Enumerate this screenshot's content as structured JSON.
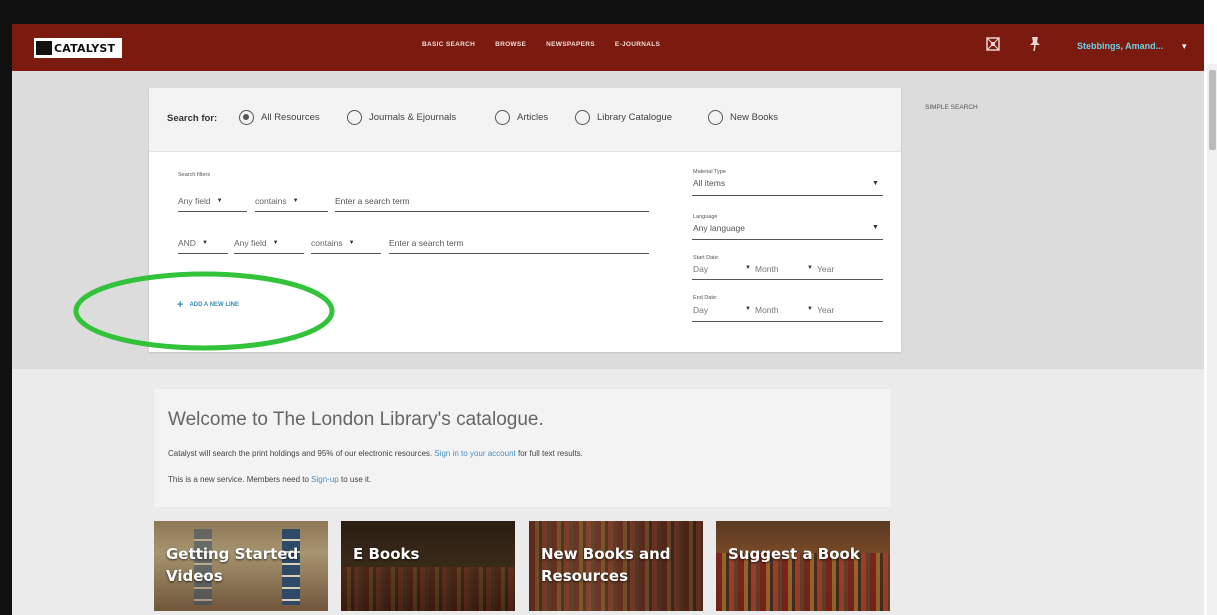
{
  "app": {
    "logo": "CATALYST"
  },
  "nav": {
    "items": [
      {
        "label": "BASIC SEARCH"
      },
      {
        "label": "BROWSE"
      },
      {
        "label": "NEWSPAPERS"
      },
      {
        "label": "E-JOURNALS"
      }
    ]
  },
  "user": {
    "name": "Stebbings, Amand...",
    "caret": "▾"
  },
  "search": {
    "search_for_label": "Search for:",
    "scopes": [
      {
        "label": "All Resources",
        "selected": true
      },
      {
        "label": "Journals & Ejournals",
        "selected": false
      },
      {
        "label": "Articles",
        "selected": false
      },
      {
        "label": "Library Catalogue",
        "selected": false
      },
      {
        "label": "New Books",
        "selected": false
      }
    ],
    "filters_label": "Search filters",
    "rows": [
      {
        "operator": "",
        "field": "Any field",
        "match": "contains",
        "term_placeholder": "Enter a search term"
      },
      {
        "operator": "AND",
        "field": "Any field",
        "match": "contains",
        "term_placeholder": "Enter a search term"
      }
    ],
    "add_line_label": "ADD A NEW LINE",
    "material_type": {
      "label": "Material Type",
      "value": "All items"
    },
    "language": {
      "label": "Language",
      "value": "Any language"
    },
    "start_date": {
      "label": "Start Date:",
      "day": "Day",
      "month": "Month",
      "year": "Year"
    },
    "end_date": {
      "label": "End Date:",
      "day": "Day",
      "month": "Month",
      "year": "Year"
    }
  },
  "side": {
    "simple_search_label": "SIMPLE SEARCH"
  },
  "welcome": {
    "title": "Welcome to The London Library's catalogue.",
    "line1_before": "Catalyst will search the print holdings and 95% of our electronic resources. ",
    "line1_link": "Sign in to your account",
    "line1_after": " for full text results.",
    "line2_before": "This is a new service. Members need to ",
    "line2_link": "Sign-up",
    "line2_after": " to use it."
  },
  "tiles": [
    {
      "title_line1": "Getting Started",
      "title_line2": "Videos"
    },
    {
      "title_line1": "E Books",
      "title_line2": ""
    },
    {
      "title_line1": "New Books and",
      "title_line2": "Resources"
    },
    {
      "title_line1": "Suggest a Book",
      "title_line2": ""
    }
  ],
  "colors": {
    "brand": "#7b1a0e",
    "user_link": "#6bd2e6",
    "link": "#4a90c2",
    "highlight": "#33c33a"
  },
  "icons": [
    "library-card-icon",
    "pin-icon",
    "radio-icon",
    "plus-icon",
    "dropdown-icon"
  ]
}
